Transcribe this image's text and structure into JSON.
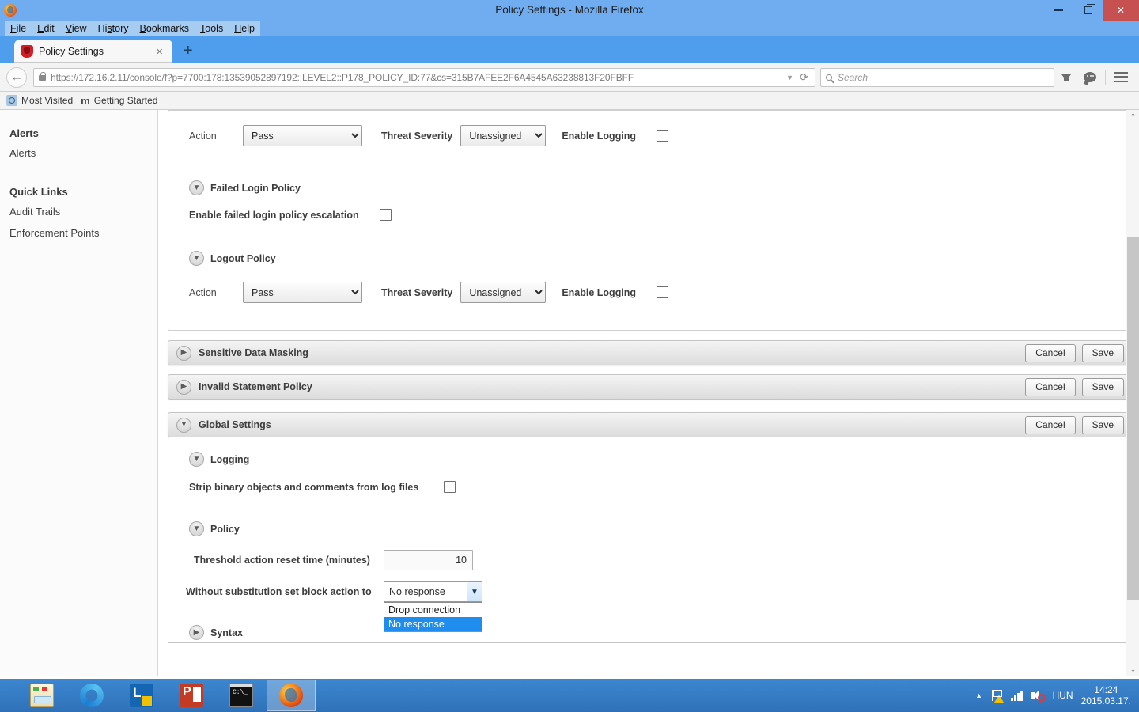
{
  "window": {
    "title": "Policy Settings - Mozilla Firefox",
    "minimize_label": "Minimize",
    "restore_label": "Restore",
    "close_label": "Close"
  },
  "menubar": {
    "items": [
      {
        "label": "File"
      },
      {
        "label": "Edit"
      },
      {
        "label": "View"
      },
      {
        "label": "History"
      },
      {
        "label": "Bookmarks"
      },
      {
        "label": "Tools"
      },
      {
        "label": "Help"
      }
    ]
  },
  "tabs": {
    "active": {
      "title": "Policy Settings",
      "close_label": "×"
    },
    "new_tab_label": "+"
  },
  "navbar": {
    "back_label": "←",
    "url": "https://172.16.2.11/console/f?p=7700:178:13539052897192::LEVEL2::P178_POLICY_ID:77&cs=315B7AFEE2F6A4545A63238813F20FBFF",
    "url_dropdown_label": "▼",
    "reload_label": "⟳",
    "search_placeholder": "Search",
    "search_value": ""
  },
  "bookmarks": {
    "items": [
      {
        "label": "Most Visited",
        "icon": "most-visited-icon"
      },
      {
        "label": "Getting Started",
        "icon": "mozilla-m-icon"
      }
    ]
  },
  "sidebar": {
    "sections": [
      {
        "heading": "Alerts",
        "links": [
          {
            "label": "Alerts"
          }
        ]
      },
      {
        "heading": "Quick Links",
        "links": [
          {
            "label": "Audit Trails"
          },
          {
            "label": "Enforcement Points"
          }
        ]
      }
    ]
  },
  "main": {
    "top_panel": {
      "action_row": {
        "action_label": "Action",
        "action_value": "Pass",
        "action_options": [
          "Pass"
        ],
        "threat_severity_label": "Threat Severity",
        "threat_severity_value": "Unassigned",
        "threat_severity_options": [
          "Unassigned"
        ],
        "enable_logging_label": "Enable Logging",
        "enable_logging_checked": false
      },
      "failed_login_policy": {
        "title": "Failed Login Policy",
        "expanded": true,
        "escalation_label": "Enable failed login policy escalation",
        "escalation_checked": false
      },
      "logout_policy": {
        "title": "Logout Policy",
        "expanded": true,
        "action_label": "Action",
        "action_value": "Pass",
        "action_options": [
          "Pass"
        ],
        "threat_severity_label": "Threat Severity",
        "threat_severity_value": "Unassigned",
        "threat_severity_options": [
          "Unassigned"
        ],
        "enable_logging_label": "Enable Logging",
        "enable_logging_checked": false
      }
    },
    "accordions": [
      {
        "title": "Sensitive Data Masking",
        "expanded": false,
        "cancel_label": "Cancel",
        "save_label": "Save"
      },
      {
        "title": "Invalid Statement Policy",
        "expanded": false,
        "cancel_label": "Cancel",
        "save_label": "Save"
      },
      {
        "title": "Global Settings",
        "expanded": true,
        "cancel_label": "Cancel",
        "save_label": "Save"
      }
    ],
    "global_settings": {
      "logging": {
        "title": "Logging",
        "expanded": true,
        "strip_label": "Strip binary objects and comments from log files",
        "strip_checked": false
      },
      "policy": {
        "title": "Policy",
        "expanded": true,
        "threshold_label": "Threshold action reset time (minutes)",
        "threshold_value": "10",
        "block_action_label": "Without substitution set block action to",
        "block_action_value": "No response",
        "block_action_options": [
          "Drop connection",
          "No response"
        ],
        "block_action_open": true,
        "block_action_selected": "No response"
      },
      "syntax": {
        "title": "Syntax",
        "expanded": false
      }
    }
  },
  "scrollbar": {
    "up_label": "⌃",
    "down_label": "⌄"
  },
  "taskbar": {
    "items": [
      {
        "name": "file-explorer",
        "label": "File Explorer",
        "active": false
      },
      {
        "name": "internet-explorer",
        "label": "Internet Explorer",
        "active": false
      },
      {
        "name": "lync",
        "label": "Lync",
        "active": false
      },
      {
        "name": "powerpoint",
        "label": "PowerPoint",
        "active": false
      },
      {
        "name": "command-prompt",
        "label": "Command Prompt",
        "active": false
      },
      {
        "name": "firefox",
        "label": "Mozilla Firefox",
        "active": true
      }
    ],
    "tray": {
      "show_hidden_label": "▲",
      "language": "HUN",
      "time": "14:24",
      "date": "2015.03.17."
    }
  },
  "colors": {
    "titlebar": "#6fadf0",
    "close_button": "#c75050",
    "taskbar": "#3c87d0",
    "dropdown_highlight": "#1f8ded",
    "accordion_bg": "#ecECec"
  }
}
